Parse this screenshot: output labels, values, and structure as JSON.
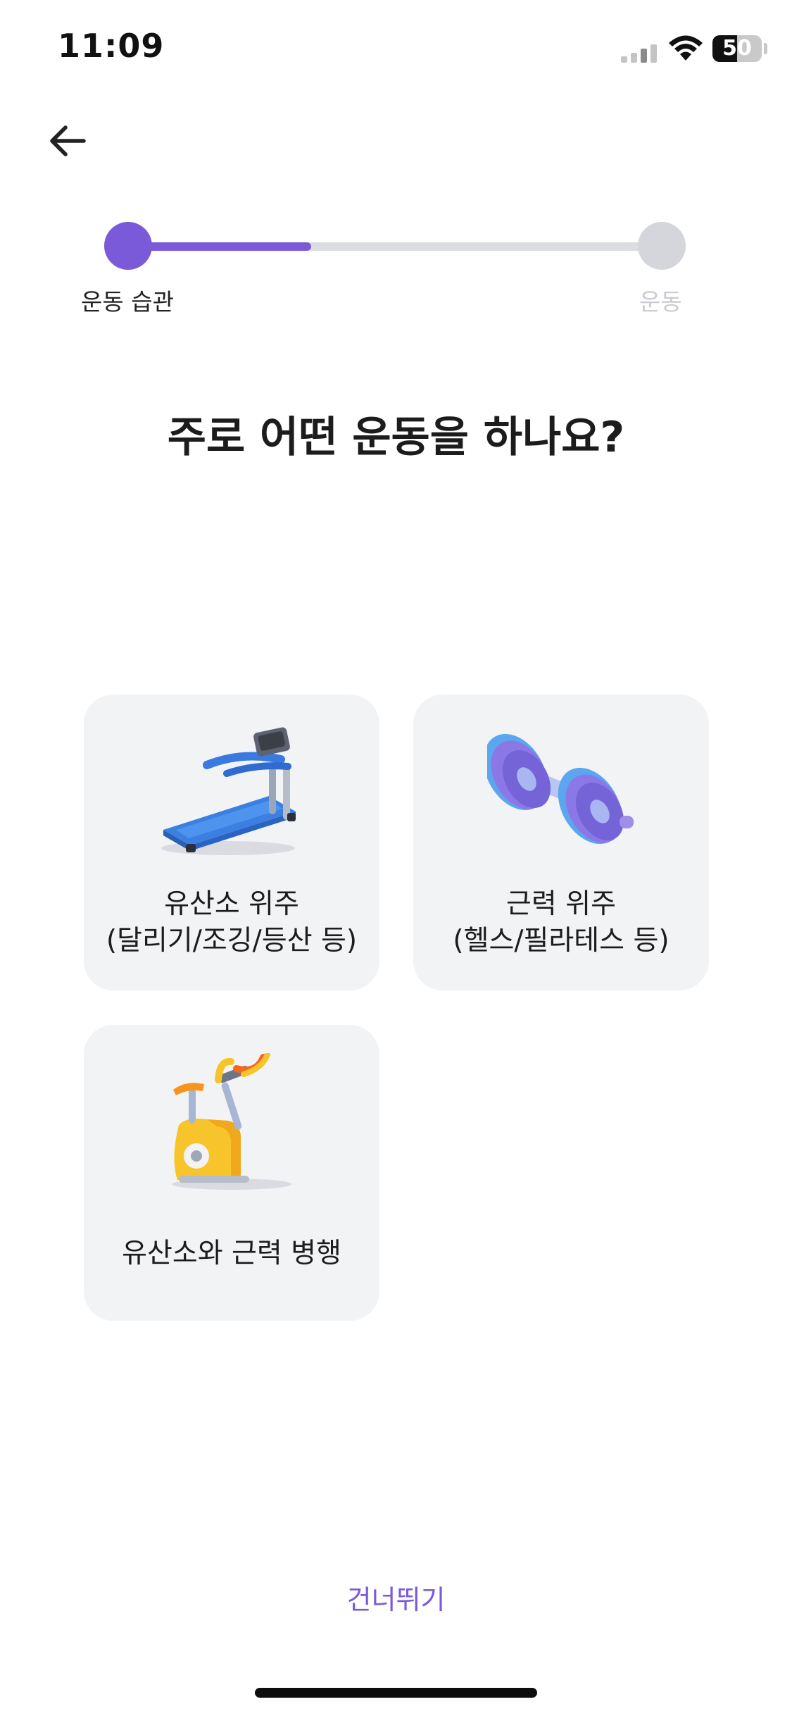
{
  "status_bar": {
    "time": "11:09",
    "battery": "50",
    "battery_level": 0.5
  },
  "header": {
    "back_icon": "arrow-left-icon"
  },
  "progress": {
    "fraction": 0.34,
    "steps": [
      {
        "label": "운동 습관"
      },
      {
        "label": "운동"
      }
    ]
  },
  "title": "주로 어떤 운동을 하나요?",
  "options": [
    {
      "icon": "treadmill-icon",
      "line1": "유산소 위주",
      "line2": "(달리기/조깅/등산 등)"
    },
    {
      "icon": "dumbbell-icon",
      "line1": "근력 위주",
      "line2": "(헬스/필라테스 등)"
    },
    {
      "icon": "exercise-bike-icon",
      "line1": "유산소와 근력 병행"
    }
  ],
  "skip_label": "건너뛰기",
  "colors": {
    "accent": "#7b5ad9",
    "card_bg": "#f2f3f5",
    "track": "#dcdde1"
  }
}
